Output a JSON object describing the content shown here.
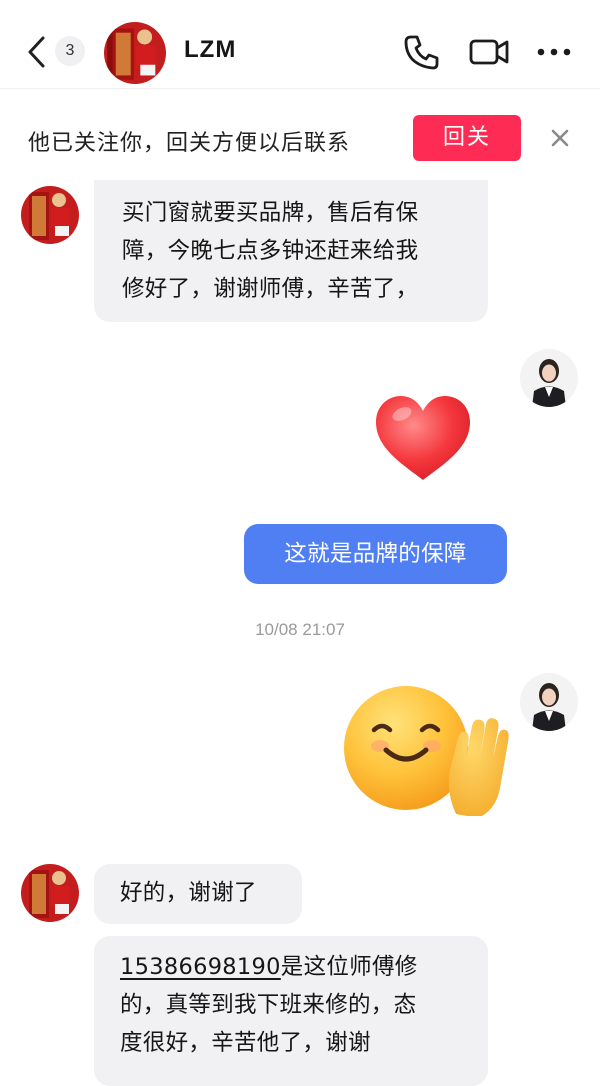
{
  "header": {
    "back_label": "back",
    "unread_count": "3",
    "contact_name": "LZM"
  },
  "follow_bar": {
    "text": "他已关注你，回关方便以后联系",
    "follow_button": "回关"
  },
  "messages": {
    "m1": {
      "text": "买门窗就要买品牌，售后有保障，今晚七点多钟还赶来给我修好了，谢谢师傅，辛苦了，",
      "lines": [
        "买门窗就要买品牌，售后有保",
        "障，今晚七点多钟还赶来给我",
        "修好了，谢谢师傅，辛苦了，"
      ]
    },
    "m2": {
      "sticker": "heart-sticker"
    },
    "m3": {
      "text": "这就是品牌的保障"
    },
    "timestamp": "10/08 21:07",
    "m4": {
      "sticker": "smile-wave-sticker"
    },
    "m5": {
      "text": "好的，谢谢了"
    },
    "m6": {
      "phone": "15386698190",
      "line1_rest": "是这位师傅修",
      "line2": "的，真等到我下班来修的，态",
      "line3": "度很好，辛苦他了，谢谢"
    }
  },
  "colors": {
    "follow_button": "#fe2c55",
    "outgoing_bubble": "#4f7ff3",
    "incoming_bubble": "#f1f1f3"
  }
}
